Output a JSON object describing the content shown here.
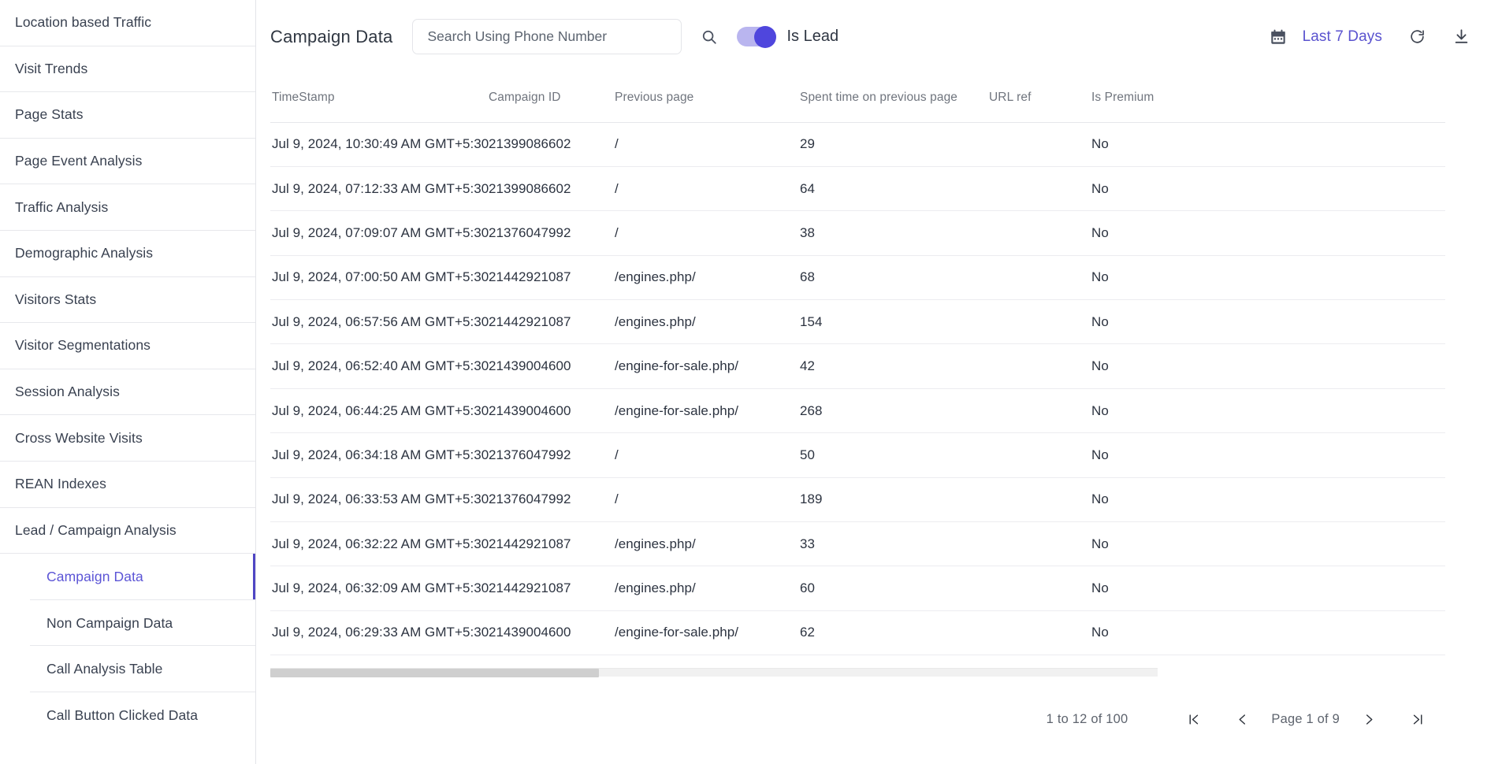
{
  "sidebar": {
    "items": [
      {
        "label": "Location based Traffic"
      },
      {
        "label": "Visit Trends"
      },
      {
        "label": "Page Stats"
      },
      {
        "label": "Page Event Analysis"
      },
      {
        "label": "Traffic Analysis"
      },
      {
        "label": "Demographic Analysis"
      },
      {
        "label": "Visitors Stats"
      },
      {
        "label": "Visitor Segmentations"
      },
      {
        "label": "Session Analysis"
      },
      {
        "label": "Cross Website Visits"
      },
      {
        "label": "REAN Indexes"
      },
      {
        "label": "Lead / Campaign Analysis"
      }
    ],
    "subitems": [
      {
        "label": "Campaign Data",
        "active": true
      },
      {
        "label": "Non Campaign Data",
        "active": false
      },
      {
        "label": "Call Analysis Table",
        "active": false
      },
      {
        "label": "Call Button Clicked Data",
        "active": false
      }
    ],
    "active_color": "#5c55d6"
  },
  "toolbar": {
    "title": "Campaign Data",
    "search_placeholder": "Search Using Phone Number",
    "search_value": "",
    "search_icon": "search-icon",
    "toggle_label": "Is Lead",
    "toggle_on": true,
    "toggle_accent": "#4f46dd",
    "calendar_icon": "calendar-icon",
    "date_range": "Last 7 Days",
    "date_range_color": "#5a53cf",
    "refresh_icon": "refresh-icon",
    "download_icon": "download-icon"
  },
  "table": {
    "columns": [
      "TimeStamp",
      "Campaign ID",
      "Previous page",
      "Spent time on previous page",
      "URL ref",
      "Is Premium"
    ],
    "rows": [
      {
        "timestamp": "Jul 9, 2024, 10:30:49 AM GMT+5:30",
        "campaign_id": "21399086602",
        "previous_page": "/",
        "spent_time": "29",
        "url_ref": "",
        "is_premium": "No"
      },
      {
        "timestamp": "Jul 9, 2024, 07:12:33 AM GMT+5:30",
        "campaign_id": "21399086602",
        "previous_page": "/",
        "spent_time": "64",
        "url_ref": "",
        "is_premium": "No"
      },
      {
        "timestamp": "Jul 9, 2024, 07:09:07 AM GMT+5:30",
        "campaign_id": "21376047992",
        "previous_page": "/",
        "spent_time": "38",
        "url_ref": "",
        "is_premium": "No"
      },
      {
        "timestamp": "Jul 9, 2024, 07:00:50 AM GMT+5:30",
        "campaign_id": "21442921087",
        "previous_page": "/engines.php/",
        "spent_time": "68",
        "url_ref": "",
        "is_premium": "No"
      },
      {
        "timestamp": "Jul 9, 2024, 06:57:56 AM GMT+5:30",
        "campaign_id": "21442921087",
        "previous_page": "/engines.php/",
        "spent_time": "154",
        "url_ref": "",
        "is_premium": "No"
      },
      {
        "timestamp": "Jul 9, 2024, 06:52:40 AM GMT+5:30",
        "campaign_id": "21439004600",
        "previous_page": "/engine-for-sale.php/",
        "spent_time": "42",
        "url_ref": "",
        "is_premium": "No"
      },
      {
        "timestamp": "Jul 9, 2024, 06:44:25 AM GMT+5:30",
        "campaign_id": "21439004600",
        "previous_page": "/engine-for-sale.php/",
        "spent_time": "268",
        "url_ref": "",
        "is_premium": "No"
      },
      {
        "timestamp": "Jul 9, 2024, 06:34:18 AM GMT+5:30",
        "campaign_id": "21376047992",
        "previous_page": "/",
        "spent_time": "50",
        "url_ref": "",
        "is_premium": "No"
      },
      {
        "timestamp": "Jul 9, 2024, 06:33:53 AM GMT+5:30",
        "campaign_id": "21376047992",
        "previous_page": "/",
        "spent_time": "189",
        "url_ref": "",
        "is_premium": "No"
      },
      {
        "timestamp": "Jul 9, 2024, 06:32:22 AM GMT+5:30",
        "campaign_id": "21442921087",
        "previous_page": "/engines.php/",
        "spent_time": "33",
        "url_ref": "",
        "is_premium": "No"
      },
      {
        "timestamp": "Jul 9, 2024, 06:32:09 AM GMT+5:30",
        "campaign_id": "21442921087",
        "previous_page": "/engines.php/",
        "spent_time": "60",
        "url_ref": "",
        "is_premium": "No"
      },
      {
        "timestamp": "Jul 9, 2024, 06:29:33 AM GMT+5:30",
        "campaign_id": "21439004600",
        "previous_page": "/engine-for-sale.php/",
        "spent_time": "62",
        "url_ref": "",
        "is_premium": "No"
      }
    ]
  },
  "pagination": {
    "range_text": "1 to 12 of 100",
    "page_text": "Page 1 of 9",
    "first_icon": "first-page-icon",
    "prev_icon": "prev-page-icon",
    "next_icon": "next-page-icon",
    "last_icon": "last-page-icon"
  }
}
